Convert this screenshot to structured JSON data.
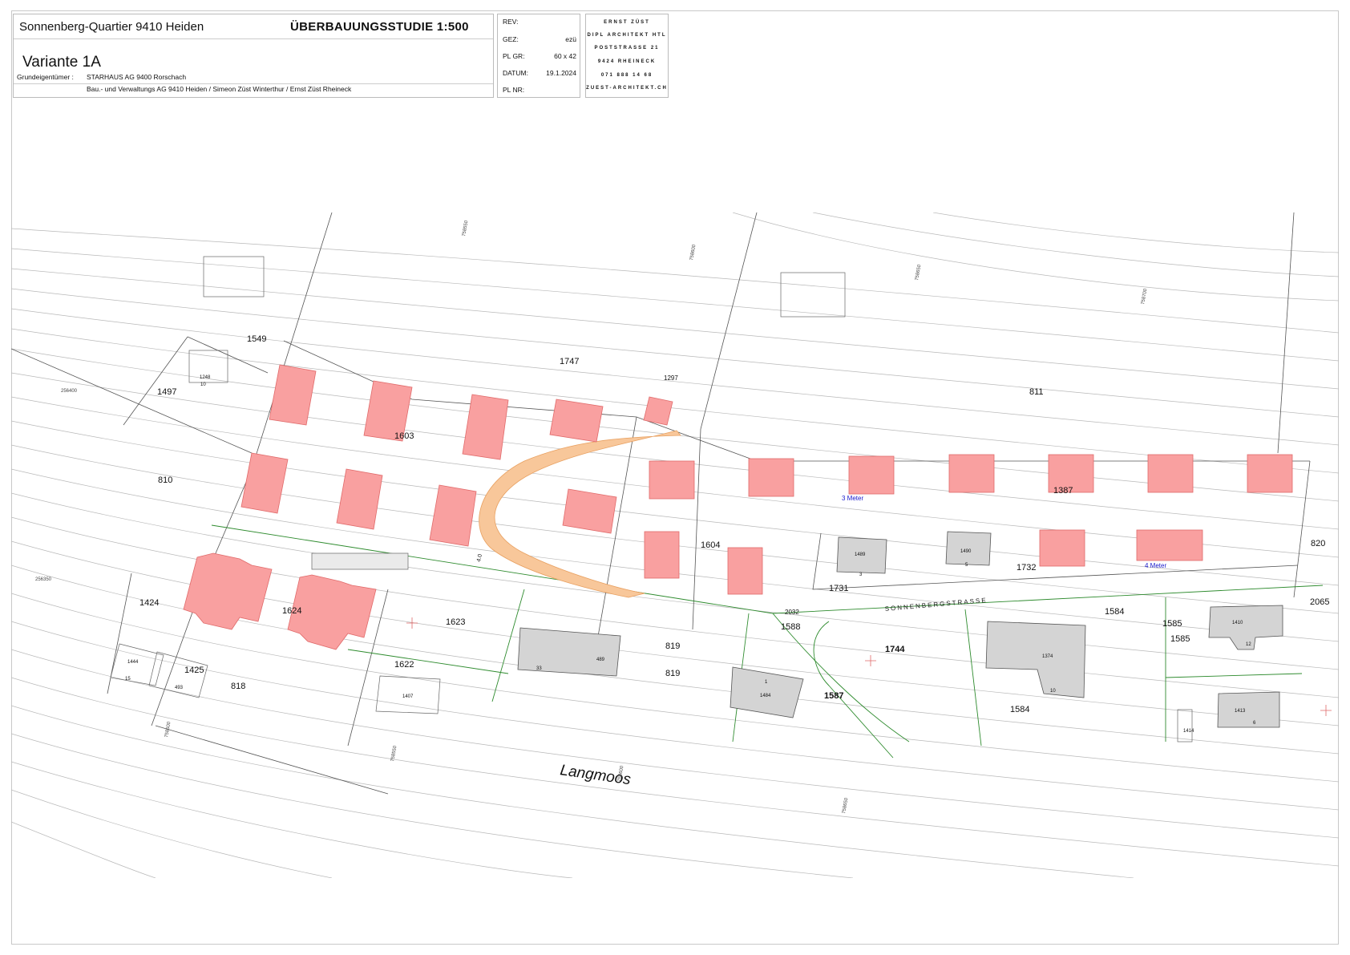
{
  "title": {
    "project": "Sonnenberg-Quartier  9410  Heiden",
    "study": "ÜBERBAUUNGSSTUDIE   1:500",
    "variant": "Variante 1A",
    "owner_label": "Grundeigentümer :",
    "owner_line1": "STARHAUS AG   9400 Rorschach",
    "owner_line2": "Bau.- und Verwaltungs AG  9410  Heiden /  Simeon Züst Winterthur /   Ernst Züst Rheineck"
  },
  "meta": {
    "rev_label": "REV:",
    "rev_value": "",
    "gez_label": "GEZ:",
    "gez_value": "ezü",
    "plgr_label": "PL GR:",
    "plgr_value": "60 x 42",
    "datum_label": "DATUM:",
    "datum_value": "19.1.2024",
    "plnr_label": "PL  NR:",
    "plnr_value": ""
  },
  "architect": {
    "line1": "ERNST   ZÜST",
    "line2": "DIPL  ARCHITEKT  HTL",
    "line3": "POSTSTRASSE  21",
    "line4": "9424  RHEINECK",
    "line5": "071  888  14  68",
    "line6": "ZUEST-ARCHITEKT.CH"
  },
  "map": {
    "parcels": [
      "1549",
      "1747",
      "1297",
      "811",
      "1497",
      "1603",
      "810",
      "1387",
      "1604",
      "1732",
      "1731",
      "820",
      "1424",
      "1624",
      "1623",
      "2032",
      "1588",
      "1744",
      "1584",
      "1585",
      "1585",
      "2065",
      "1425",
      "1622",
      "818",
      "819",
      "819",
      "1587",
      "1584"
    ],
    "building_numbers": [
      "1248",
      "10",
      "1489",
      "3",
      "1490",
      "5",
      "33",
      "489",
      "1",
      "1484",
      "1374",
      "10",
      "1410",
      "12",
      "1413",
      "6",
      "1414",
      "1444",
      "15",
      "493",
      "1407"
    ],
    "coords": [
      "758550",
      "758600",
      "758650",
      "758700",
      "256400",
      "256350",
      "758500",
      "758550",
      "758600",
      "758650"
    ],
    "spacing_3m": "3 Meter",
    "spacing_4m": "4 Meter",
    "street": "SONNENBERGSTRASSE",
    "place": "Langmoos",
    "road_dim": "4.0"
  },
  "colors": {
    "new_building": "#f9a0a0",
    "new_building_stroke": "#e06a6a",
    "access_road": "#f8c79a",
    "existing_building": "#d4d4d4",
    "contour": "#b5b5b5",
    "parcel_line": "#555555",
    "green_line": "#2e8b2e"
  }
}
